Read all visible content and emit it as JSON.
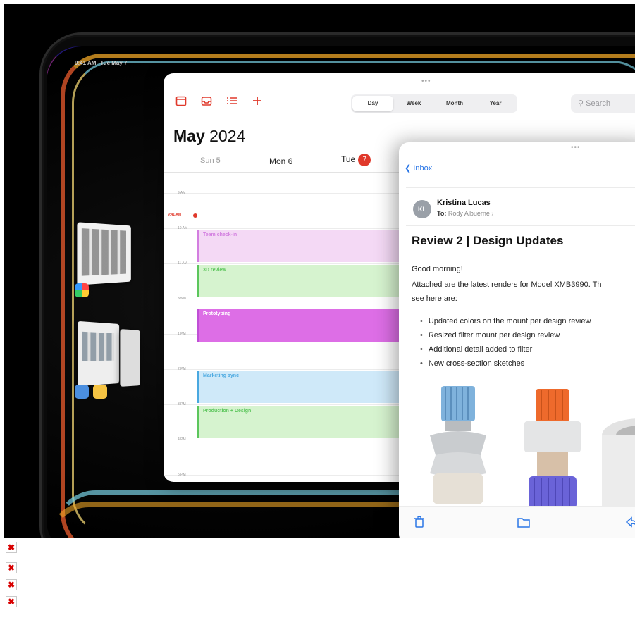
{
  "status_bar": {
    "time": "9:41 AM",
    "date": "Tue May 7"
  },
  "calendar": {
    "toolbar_icons": [
      "calendar-icon",
      "inbox-tray-icon",
      "list-icon",
      "plus-icon"
    ],
    "view_tabs": [
      "Day",
      "Week",
      "Month",
      "Year"
    ],
    "active_view": "Day",
    "search_placeholder": "Search",
    "title_month": "May",
    "title_year": "2024",
    "days": [
      {
        "label": "Sun 5"
      },
      {
        "label": "Mon 6"
      },
      {
        "label": "Tue",
        "badge": "7"
      }
    ],
    "hours": [
      "9 AM",
      "10 AM",
      "11 AM",
      "Noon",
      "1 PM",
      "2 PM",
      "3 PM",
      "4 PM",
      "5 PM"
    ],
    "now_label": "9:41 AM",
    "events": [
      {
        "title": "Team check-in",
        "color": "#d37ee0",
        "fill": "#f4d9f5"
      },
      {
        "title": "3D review",
        "color": "#5cc65c",
        "fill": "#d6f3cf"
      },
      {
        "title": "Prototyping",
        "color": "#c04fd6",
        "fill": "#dd6ee6"
      },
      {
        "title": "Marketing sync",
        "color": "#49a8e0",
        "fill": "#cfe9f9"
      },
      {
        "title": "Production + Design",
        "color": "#5cc65c",
        "fill": "#d6f3cf"
      }
    ]
  },
  "mail": {
    "back_label": "Inbox",
    "sender_initials": "KL",
    "sender_name": "Kristina Lucas",
    "to_prefix": "To:",
    "to_name": "Rody Albuerne",
    "subject": "Review 2 | Design Updates",
    "greeting": "Good morning!",
    "body_line1": "Attached are the latest renders for Model XMB3990. Th",
    "body_line2": "see here are:",
    "bullets": [
      "Updated colors on the mount per design review",
      "Resized filter mount per design review",
      "Additional detail added to filter",
      "New cross-section sketches"
    ],
    "toolbar_icons": [
      "trash-icon",
      "folder-icon",
      "reply-icon"
    ]
  },
  "colors": {
    "accent_red": "#e0392b",
    "accent_blue": "#2a76e6"
  }
}
